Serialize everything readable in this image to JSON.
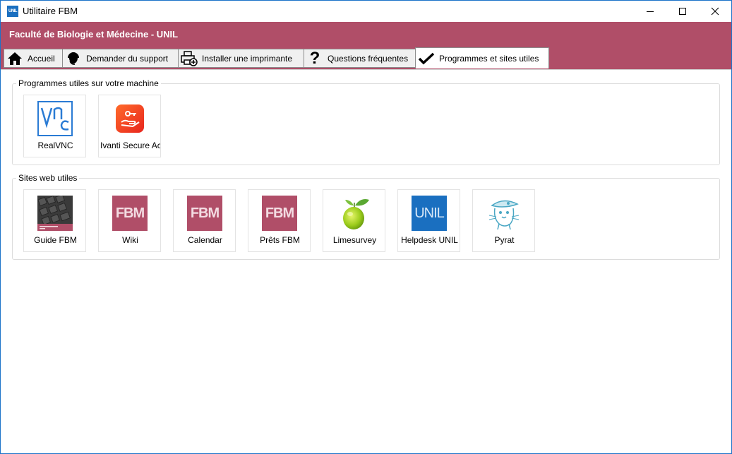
{
  "window": {
    "title": "Utilitaire FBM",
    "app_icon_text": "UNIL"
  },
  "banner": {
    "title": "Faculté de Biologie et Médecine - UNIL",
    "color": "#b04e68"
  },
  "tabs": [
    {
      "label": "Accueil",
      "icon": "home-icon"
    },
    {
      "label": "Demander du support",
      "icon": "headset-icon"
    },
    {
      "label": "Installer une imprimante",
      "icon": "printer-add-icon"
    },
    {
      "label": "Questions fréquentes",
      "icon": "question-mark-icon"
    },
    {
      "label": "Programmes et sites utiles",
      "icon": "checkmark-icon",
      "active": true
    }
  ],
  "programs_group": {
    "label": "Programmes utiles sur votre machine",
    "items": [
      {
        "label": "RealVNC",
        "icon": "realvnc-icon"
      },
      {
        "label": "Ivanti Secure Acc",
        "icon": "ivanti-icon"
      }
    ]
  },
  "sites_group": {
    "label": "Sites web utiles",
    "items": [
      {
        "label": "Guide FBM",
        "icon": "guide-keyboard-icon"
      },
      {
        "label": "Wiki",
        "icon": "fbm-logo-icon",
        "logo_text": "FBM"
      },
      {
        "label": "Calendar",
        "icon": "fbm-logo-icon",
        "logo_text": "FBM"
      },
      {
        "label": "Prêts FBM",
        "icon": "fbm-logo-icon",
        "logo_text": "FBM"
      },
      {
        "label": "Limesurvey",
        "icon": "lime-icon"
      },
      {
        "label": "Helpdesk UNIL",
        "icon": "unil-logo-icon",
        "logo_text": "UNIL"
      },
      {
        "label": "Pyrat",
        "icon": "pirate-rat-icon"
      }
    ]
  }
}
